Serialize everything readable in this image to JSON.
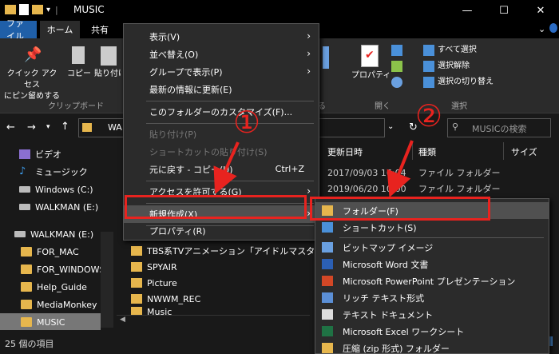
{
  "window": {
    "title": "MUSIC",
    "min": "—",
    "max": "☐",
    "close": "✕"
  },
  "tabs": {
    "file": "ファイル",
    "home": "ホーム",
    "share": "共有"
  },
  "ribbon": {
    "pin_line1": "クイック アクセス",
    "pin_line2": "にピン留めする",
    "copy": "コピー",
    "paste": "貼り付け",
    "clipboard_group": "クリップボード",
    "properties": "プロパティ",
    "open_group": "開く",
    "select_all": "すべて選択",
    "select_none": "選択解除",
    "invert_select": "選択の切り替え",
    "select_group": "選択"
  },
  "address": {
    "path": "WA",
    "search_placeholder": "MUSICの検索"
  },
  "nav": {
    "items": [
      {
        "label": "ビデオ",
        "icon": "video-icon"
      },
      {
        "label": "ミュージック",
        "icon": "music-icon"
      },
      {
        "label": "Windows (C:)",
        "icon": "drive-icon"
      },
      {
        "label": "WALKMAN (E:)",
        "icon": "drive-icon"
      },
      {
        "label": "WALKMAN (E:)",
        "icon": "drive-icon"
      },
      {
        "label": "FOR_MAC",
        "icon": "folder-icon"
      },
      {
        "label": "FOR_WINDOWS",
        "icon": "folder-icon"
      },
      {
        "label": "Help_Guide",
        "icon": "folder-icon"
      },
      {
        "label": "MediaMonkey",
        "icon": "folder-icon"
      },
      {
        "label": "MUSIC",
        "icon": "folder-icon"
      }
    ]
  },
  "columns": {
    "date": "更新日時",
    "type": "種類",
    "size": "サイズ"
  },
  "rows": [
    {
      "date": "2017/09/03 16:04",
      "type": "ファイル フォルダー"
    },
    {
      "date": "2019/06/20 10:00",
      "type": "ファイル フォルダー"
    }
  ],
  "files": [
    "TBS系TVアニメーション「アイドルマスター」オープ...",
    "SPYAIR",
    "Picture",
    "NWWM_REC",
    "Music"
  ],
  "status": "25 個の項目",
  "context_menu": [
    {
      "label": "表示(V)",
      "arrow": true
    },
    {
      "label": "並べ替え(O)",
      "arrow": true
    },
    {
      "label": "グループで表示(P)",
      "arrow": true
    },
    {
      "label": "最新の情報に更新(E)"
    },
    {
      "label": "このフォルダーのカスタマイズ(F)..."
    },
    {
      "label": "貼り付け(P)",
      "disabled": true
    },
    {
      "label": "ショートカットの貼り付け(S)",
      "disabled": true
    },
    {
      "label": "元に戻す - コピー(U)",
      "shortcut": "Ctrl+Z"
    },
    {
      "label": "アクセスを許可する(G)",
      "arrow": true
    },
    {
      "label": "新規作成(X)",
      "arrow": true
    },
    {
      "label": "プロパティ(R)"
    }
  ],
  "submenu": [
    {
      "label": "フォルダー(F)",
      "icon": "folder-icon",
      "color": "#e6b64d"
    },
    {
      "label": "ショートカット(S)",
      "icon": "shortcut-icon",
      "color": "#4a90d9"
    },
    {
      "label": "ビットマップ イメージ",
      "icon": "bitmap-icon",
      "color": "#6aa0e0"
    },
    {
      "label": "Microsoft Word 文書",
      "icon": "word-icon",
      "color": "#2b5fb4"
    },
    {
      "label": "Microsoft PowerPoint プレゼンテーション",
      "icon": "powerpoint-icon",
      "color": "#d24726"
    },
    {
      "label": "リッチ テキスト形式",
      "icon": "rtf-icon",
      "color": "#5b8fd6"
    },
    {
      "label": "テキスト ドキュメント",
      "icon": "text-icon",
      "color": "#dddddd"
    },
    {
      "label": "Microsoft Excel ワークシート",
      "icon": "excel-icon",
      "color": "#1f7244"
    },
    {
      "label": "圧縮 (zip 形式) フォルダー",
      "icon": "zip-icon",
      "color": "#e6b64d"
    }
  ],
  "annotations": {
    "one": "①",
    "two": "②"
  },
  "colors": {
    "annotation": "#e8231f",
    "folder": "#e6b64d",
    "file_tab": "#1f5fa8"
  }
}
